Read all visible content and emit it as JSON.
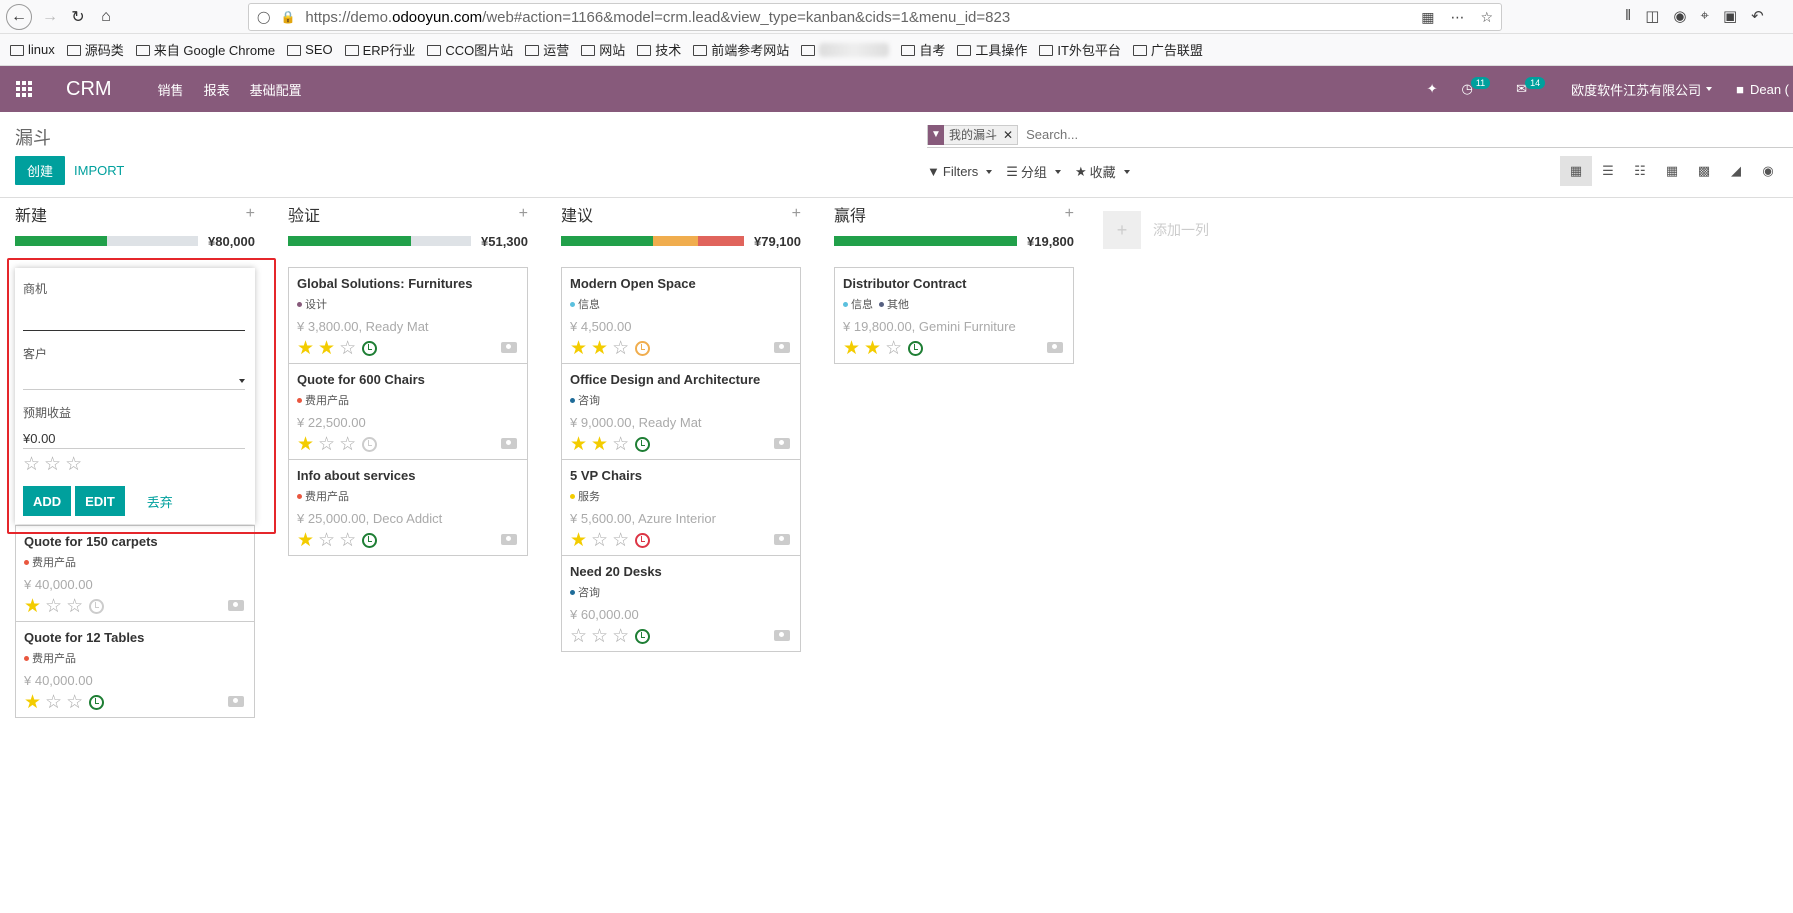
{
  "browser": {
    "url_prefix": "https://demo.",
    "url_domain": "odooyun.com",
    "url_rest": "/web#action=1166&model=crm.lead&view_type=kanban&cids=1&menu_id=823",
    "bookmarks": [
      "linux",
      "源码类",
      "来自 Google Chrome",
      "SEO",
      "ERP行业",
      "CCO图片站",
      "运营",
      "网站",
      "技术",
      "前端参考网站",
      "",
      "自考",
      "工具操作",
      "IT外包平台",
      "广告联盟"
    ]
  },
  "nav": {
    "brand": "CRM",
    "menus": [
      "销售",
      "报表",
      "基础配置"
    ],
    "activity_count": "11",
    "message_count": "14",
    "company": "欧度软件江苏有限公司",
    "user": "Dean ("
  },
  "control": {
    "breadcrumb": "漏斗",
    "create_label": "创建",
    "import_label": "IMPORT",
    "facet": "我的漏斗",
    "search_placeholder": "Search...",
    "filters": "Filters",
    "group": "分组",
    "favorites": "收藏"
  },
  "quick_create": {
    "opportunity_label": "商机",
    "opportunity_value": "",
    "customer_label": "客户",
    "customer_value": "",
    "revenue_label": "预期收益",
    "revenue_value": "¥0.00",
    "add_label": "ADD",
    "edit_label": "EDIT",
    "discard_label": "丢弃"
  },
  "add_column_label": "添加一列",
  "columns": [
    {
      "name": "新建",
      "total": "¥80,000",
      "progress": [
        {
          "color": "#21a04a",
          "pct": 50
        },
        {
          "color": "#dee2e6",
          "pct": 50
        }
      ],
      "cards": [
        {
          "title": "Quote for 150 carpets",
          "tags": [
            {
              "label": "费用产品",
              "color": "#e9573f"
            }
          ],
          "amount": "¥ 40,000.00",
          "stars": 1,
          "clock": "grey"
        },
        {
          "title": "Quote for 12 Tables",
          "tags": [
            {
              "label": "费用产品",
              "color": "#e9573f"
            }
          ],
          "amount": "¥ 40,000.00",
          "stars": 1,
          "clock": "green"
        }
      ]
    },
    {
      "name": "验证",
      "total": "¥51,300",
      "progress": [
        {
          "color": "#21a04a",
          "pct": 67
        },
        {
          "color": "#dee2e6",
          "pct": 33
        }
      ],
      "cards": [
        {
          "title": "Global Solutions: Furnitures",
          "tags": [
            {
              "label": "设计",
              "color": "#875a7b"
            }
          ],
          "amount": "¥ 3,800.00, Ready Mat",
          "stars": 2,
          "clock": "green"
        },
        {
          "title": "Quote for 600 Chairs",
          "tags": [
            {
              "label": "费用产品",
              "color": "#e9573f"
            }
          ],
          "amount": "¥ 22,500.00",
          "stars": 1,
          "clock": "grey"
        },
        {
          "title": "Info about services",
          "tags": [
            {
              "label": "费用产品",
              "color": "#e9573f"
            }
          ],
          "amount": "¥ 25,000.00, Deco Addict",
          "stars": 1,
          "clock": "green"
        }
      ]
    },
    {
      "name": "建议",
      "total": "¥79,100",
      "progress": [
        {
          "color": "#21a04a",
          "pct": 50
        },
        {
          "color": "#f0ad4e",
          "pct": 25
        },
        {
          "color": "#e0645c",
          "pct": 25
        }
      ],
      "cards": [
        {
          "title": "Modern Open Space",
          "tags": [
            {
              "label": "信息",
              "color": "#5bc0de"
            }
          ],
          "amount": "¥ 4,500.00",
          "stars": 2,
          "clock": "orange"
        },
        {
          "title": "Office Design and Architecture",
          "tags": [
            {
              "label": "咨询",
              "color": "#1f6c99"
            }
          ],
          "amount": "¥ 9,000.00, Ready Mat",
          "stars": 2,
          "clock": "green"
        },
        {
          "title": "5 VP Chairs",
          "tags": [
            {
              "label": "服务",
              "color": "#f3cc00"
            }
          ],
          "amount": "¥ 5,600.00, Azure Interior",
          "stars": 1,
          "clock": "red"
        },
        {
          "title": "Need 20 Desks",
          "tags": [
            {
              "label": "咨询",
              "color": "#1f6c99"
            }
          ],
          "amount": "¥ 60,000.00",
          "stars": 0,
          "clock": "green"
        }
      ]
    },
    {
      "name": "赢得",
      "total": "¥19,800",
      "progress": [
        {
          "color": "#21a04a",
          "pct": 100
        }
      ],
      "cards": [
        {
          "title": "Distributor Contract",
          "tags": [
            {
              "label": "信息",
              "color": "#5bc0de"
            },
            {
              "label": "其他",
              "color": "#555f80"
            }
          ],
          "amount": "¥ 19,800.00, Gemini Furniture",
          "stars": 2,
          "clock": "green"
        }
      ]
    }
  ]
}
